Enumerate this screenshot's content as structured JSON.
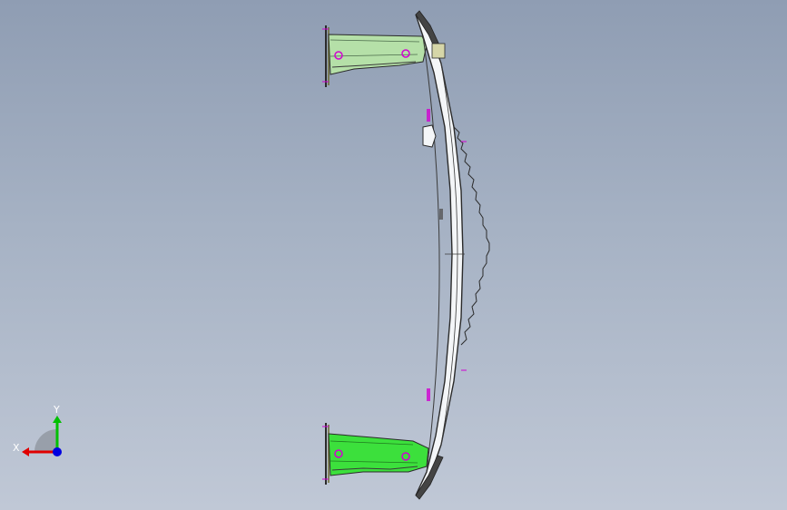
{
  "viewport": {
    "background_top": "#8f9db3",
    "background_bottom": "#c0c8d6"
  },
  "model": {
    "part_green_light": "#b5e0a8",
    "part_green_bright": "#3ce03c",
    "beam_face": "#f4f6f8",
    "edge_color": "#2a2a2a",
    "mark_color": "#d200d2"
  },
  "triad": {
    "x_label": "X",
    "y_label": "Y",
    "x_color": "#e00000",
    "y_color": "#00c000",
    "z_color": "#0000e0"
  }
}
